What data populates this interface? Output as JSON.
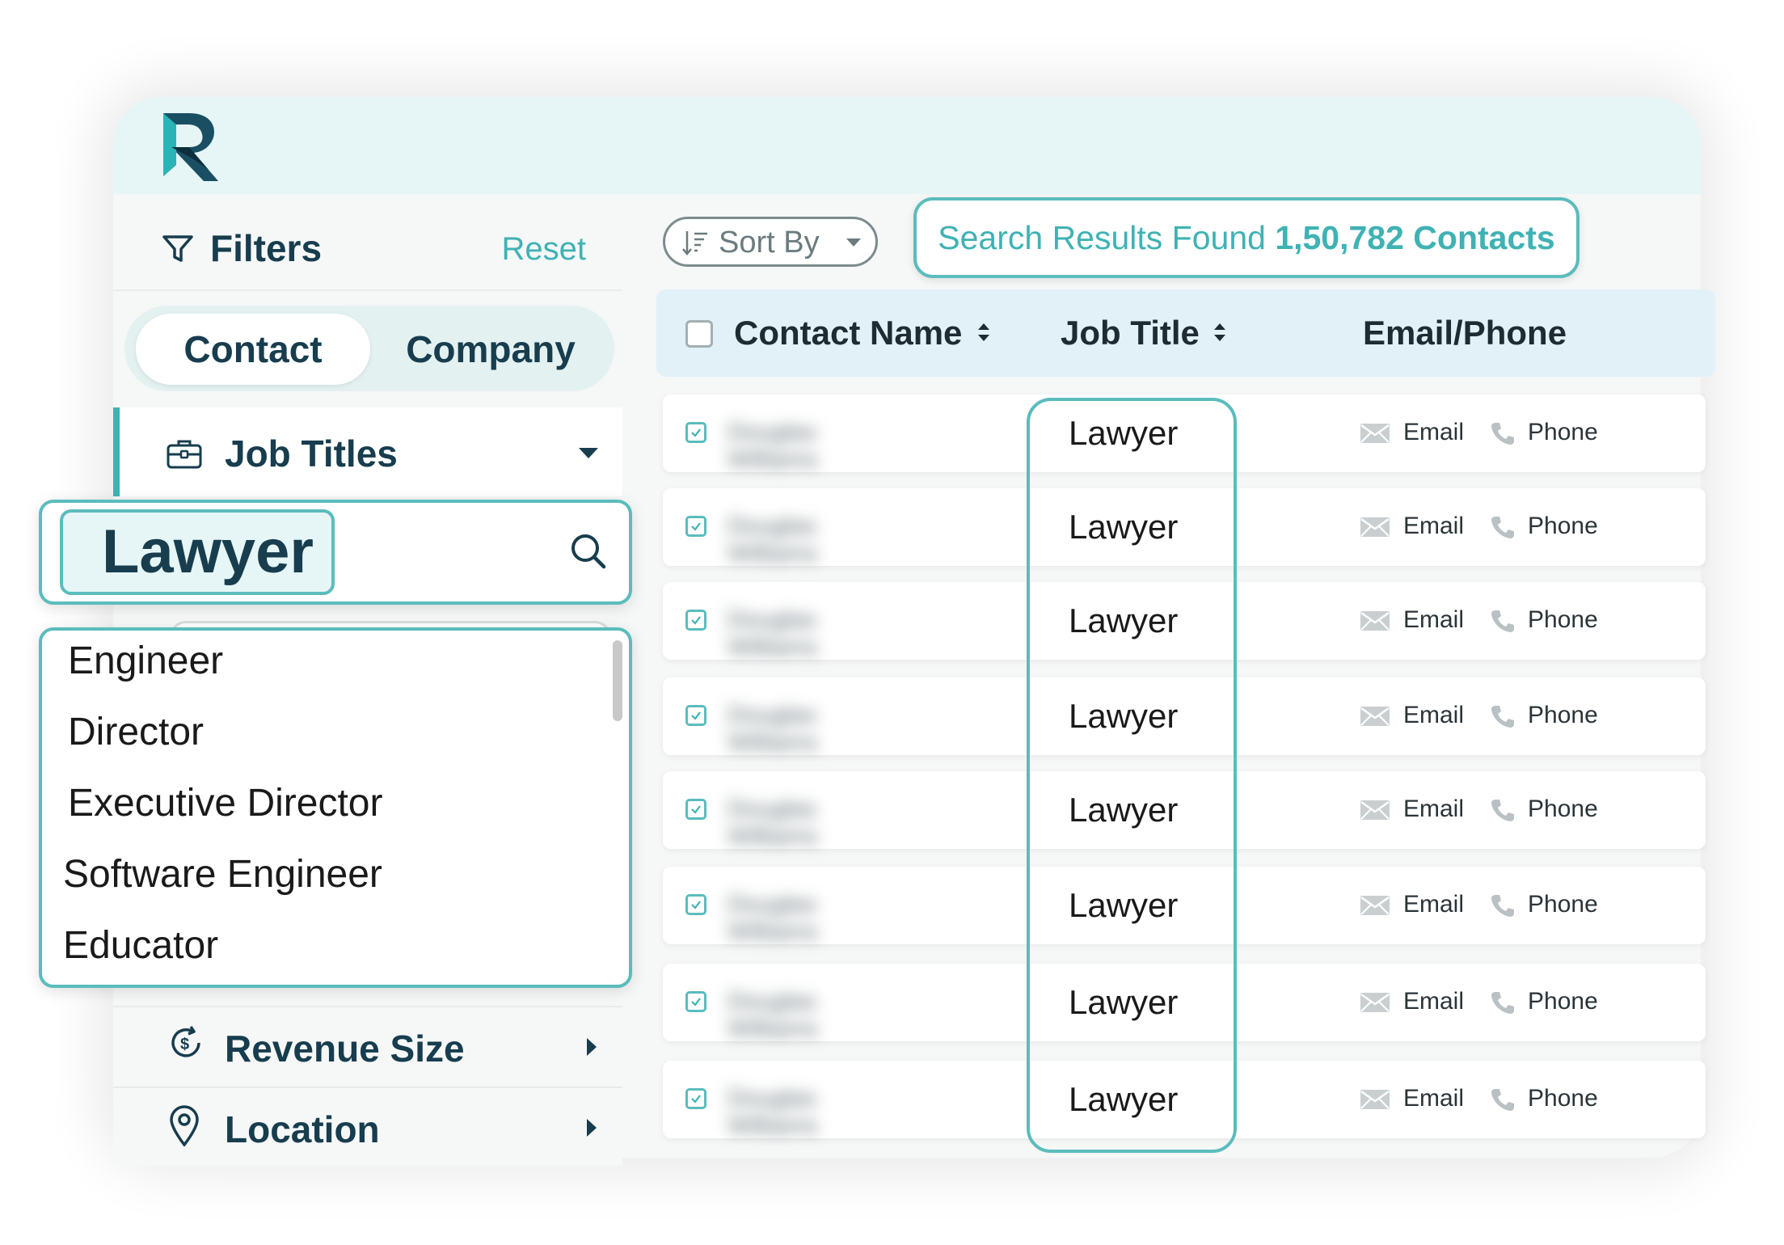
{
  "brand": {
    "logo_letter": "R",
    "colors": {
      "accent": "#3fb2b4",
      "navy": "#173d4e",
      "topbar": "#e6f6f7"
    }
  },
  "filters": {
    "title": "Filters",
    "reset_label": "Reset",
    "tabs": [
      "Contact",
      "Company"
    ],
    "active_tab": "Contact",
    "sections": {
      "job_titles": "Job Titles",
      "revenue_size": "Revenue Size",
      "location": "Location"
    },
    "search": {
      "value": "Lawyer"
    },
    "options": [
      "Engineer",
      "Director",
      "Executive Director",
      "Software Engineer",
      "Educator"
    ]
  },
  "toolbar": {
    "sort_label": "Sort By",
    "results_prefix": "Search Results Found ",
    "results_count": "1,50,782 Contacts"
  },
  "table": {
    "columns": [
      "Contact Name",
      "Job Title",
      "Email/Phone"
    ],
    "rows": [
      {
        "name": "Douglas Williams",
        "job": "Lawyer",
        "email": "Email",
        "phone": "Phone",
        "checked": true
      },
      {
        "name": "Douglas Williams",
        "job": "Lawyer",
        "email": "Email",
        "phone": "Phone",
        "checked": true
      },
      {
        "name": "Douglas Williams",
        "job": "Lawyer",
        "email": "Email",
        "phone": "Phone",
        "checked": true
      },
      {
        "name": "Douglas Williams",
        "job": "Lawyer",
        "email": "Email",
        "phone": "Phone",
        "checked": true
      },
      {
        "name": "Douglas Williams",
        "job": "Lawyer",
        "email": "Email",
        "phone": "Phone",
        "checked": true
      },
      {
        "name": "Douglas Williams",
        "job": "Lawyer",
        "email": "Email",
        "phone": "Phone",
        "checked": true
      },
      {
        "name": "Douglas Williams",
        "job": "Lawyer",
        "email": "Email",
        "phone": "Phone",
        "checked": true
      },
      {
        "name": "Douglas Williams",
        "job": "Lawyer",
        "email": "Email",
        "phone": "Phone",
        "checked": true
      }
    ]
  },
  "icons": [
    "funnel-icon",
    "briefcase-icon",
    "revenue-dollar-icon",
    "location-pin-icon",
    "search-icon",
    "sort-lines-icon",
    "email-envelope-icon",
    "phone-icon",
    "checkbox-icon"
  ]
}
